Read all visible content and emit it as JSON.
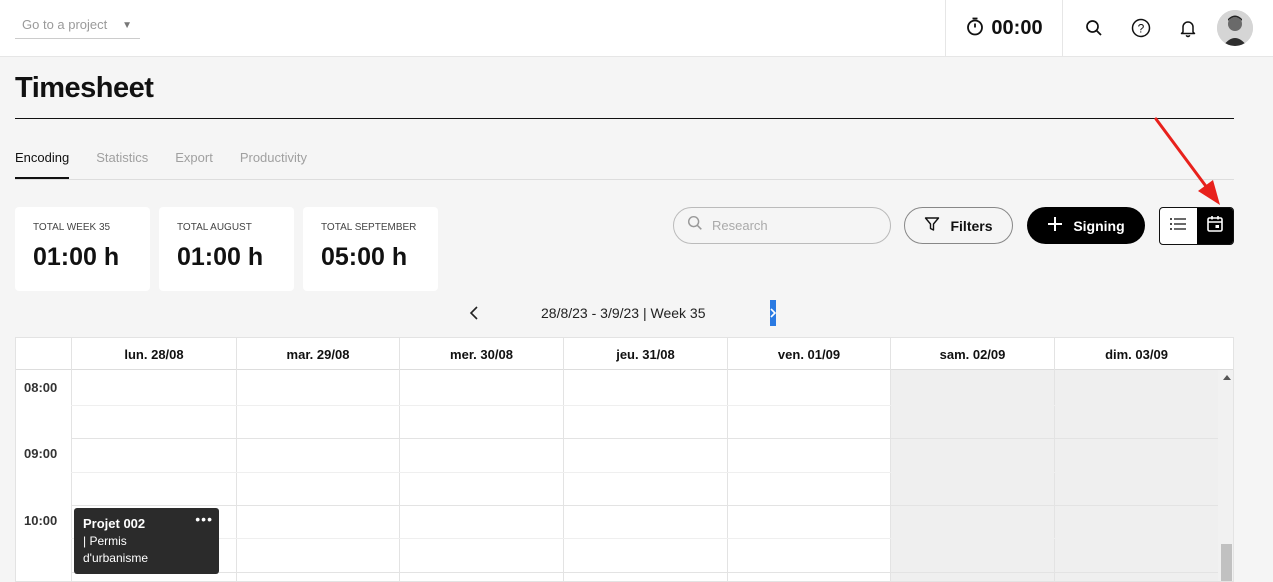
{
  "topbar": {
    "project_select": {
      "placeholder": "Go to a project"
    },
    "timer": "00:00"
  },
  "page": {
    "title": "Timesheet"
  },
  "tabs": [
    {
      "label": "Encoding",
      "active": true
    },
    {
      "label": "Statistics",
      "active": false
    },
    {
      "label": "Export",
      "active": false
    },
    {
      "label": "Productivity",
      "active": false
    }
  ],
  "stats": [
    {
      "label": "TOTAL WEEK 35",
      "value": "01:00 h"
    },
    {
      "label": "TOTAL AUGUST",
      "value": "01:00 h"
    },
    {
      "label": "TOTAL SEPTEMBER",
      "value": "05:00 h"
    }
  ],
  "toolbar": {
    "search_placeholder": "Research",
    "filters_label": "Filters",
    "signing_label": "Signing",
    "active_view": "calendar"
  },
  "week": {
    "label": "28/8/23 - 3/9/23 | Week 35"
  },
  "calendar": {
    "days": [
      "lun. 28/08",
      "mar. 29/08",
      "mer. 30/08",
      "jeu. 31/08",
      "ven. 01/09",
      "sam. 02/09",
      "dim. 03/09"
    ],
    "hours": [
      "08:00",
      "09:00",
      "10:00"
    ],
    "events": [
      {
        "title": "Projet 002",
        "description": "| Permis d'urbanisme",
        "day": "lun. 28/08",
        "start": "10:00"
      }
    ]
  },
  "colors": {
    "accent": "#000000",
    "annotation_arrow": "#e8211c",
    "nav_highlight": "#2a7ae2"
  },
  "icons": [
    "stopwatch-icon",
    "search-icon",
    "help-icon",
    "bell-icon",
    "list-view-icon",
    "calendar-view-icon",
    "filter-icon",
    "plus-icon"
  ]
}
